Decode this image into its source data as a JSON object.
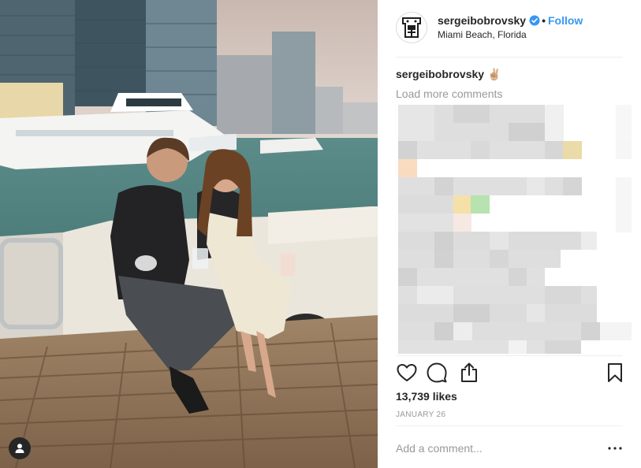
{
  "post": {
    "username": "sergeibobrovsky",
    "follow_separator": "•",
    "follow_label": "Follow",
    "location": "Miami Beach, Florida",
    "caption_username": "sergeibobrovsky",
    "caption_text": "✌🏼",
    "load_more_label": "Load more comments",
    "likes_text": "13,739 likes",
    "date_text": "JANUARY 26",
    "comment_placeholder": "Add a comment...",
    "more_options": "•••"
  },
  "icons": {
    "avatar": "hockey-crest-logo",
    "verified": "verified-badge-icon",
    "like": "heart-icon",
    "comment": "comment-bubble-icon",
    "share": "share-icon",
    "save": "bookmark-icon",
    "tag": "user-tag-icon"
  },
  "colors": {
    "accent": "#3897f0",
    "text": "#262626",
    "muted": "#999999",
    "divider": "#efefef"
  }
}
